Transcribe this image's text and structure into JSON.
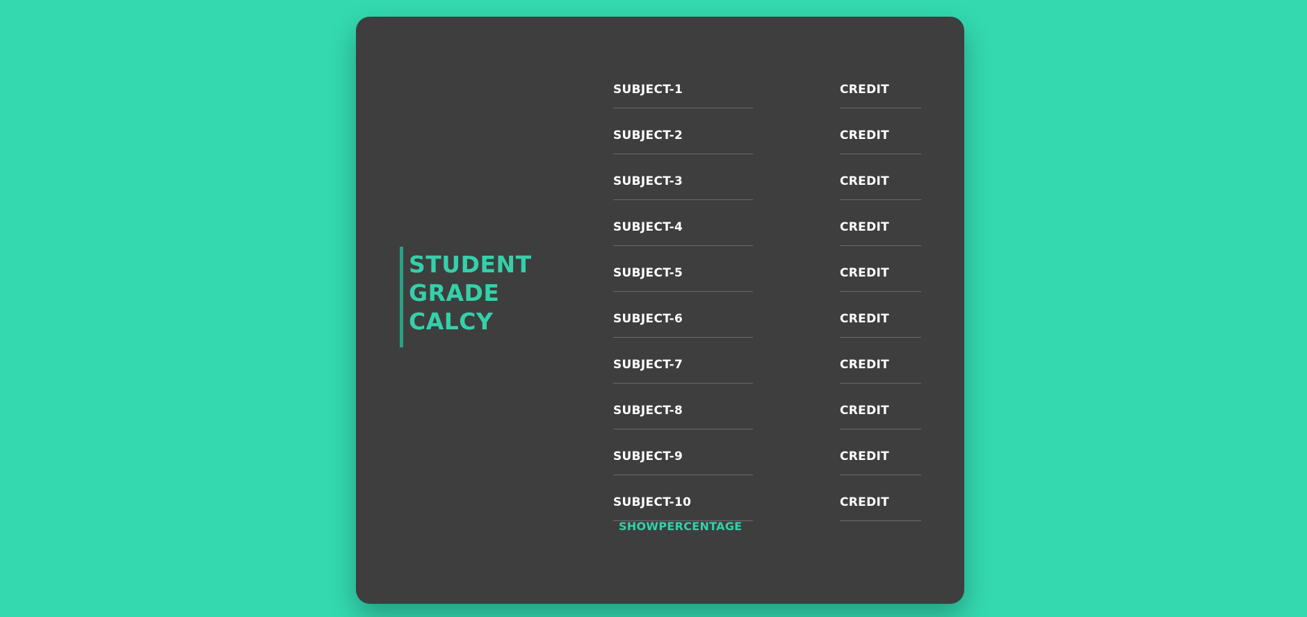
{
  "title": {
    "lines": [
      "STUDENT",
      "GRADE",
      "CALCY"
    ]
  },
  "rows": [
    {
      "subject": "SUBJECT-1",
      "credit": "CREDIT"
    },
    {
      "subject": "SUBJECT-2",
      "credit": "CREDIT"
    },
    {
      "subject": "SUBJECT-3",
      "credit": "CREDIT"
    },
    {
      "subject": "SUBJECT-4",
      "credit": "CREDIT"
    },
    {
      "subject": "SUBJECT-5",
      "credit": "CREDIT"
    },
    {
      "subject": "SUBJECT-6",
      "credit": "CREDIT"
    },
    {
      "subject": "SUBJECT-7",
      "credit": "CREDIT"
    },
    {
      "subject": "SUBJECT-8",
      "credit": "CREDIT"
    },
    {
      "subject": "SUBJECT-9",
      "credit": "CREDIT"
    },
    {
      "subject": "SUBJECT-10",
      "credit": "CREDIT"
    }
  ],
  "submit_label": "SHOWPERCENTAGE",
  "colors": {
    "background": "#34d9b0",
    "card": "#3e3e3e",
    "accent": "#34d0aa",
    "text": "#ffffff"
  }
}
